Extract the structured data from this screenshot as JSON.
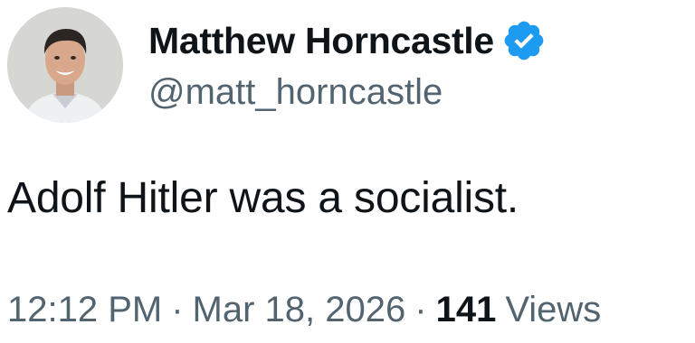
{
  "author": {
    "display_name": "Matthew Horncastle",
    "handle": "@matt_horncastle",
    "verified": true,
    "verified_color": "#1d9bf0"
  },
  "tweet": {
    "text": "Adolf Hitler was a socialist."
  },
  "meta": {
    "time": "12:12 PM",
    "separator": "·",
    "date": "Mar 18, 2026",
    "views_count": "141",
    "views_label": "Views"
  },
  "colors": {
    "text_primary": "#0f1419",
    "text_secondary": "#536471"
  }
}
